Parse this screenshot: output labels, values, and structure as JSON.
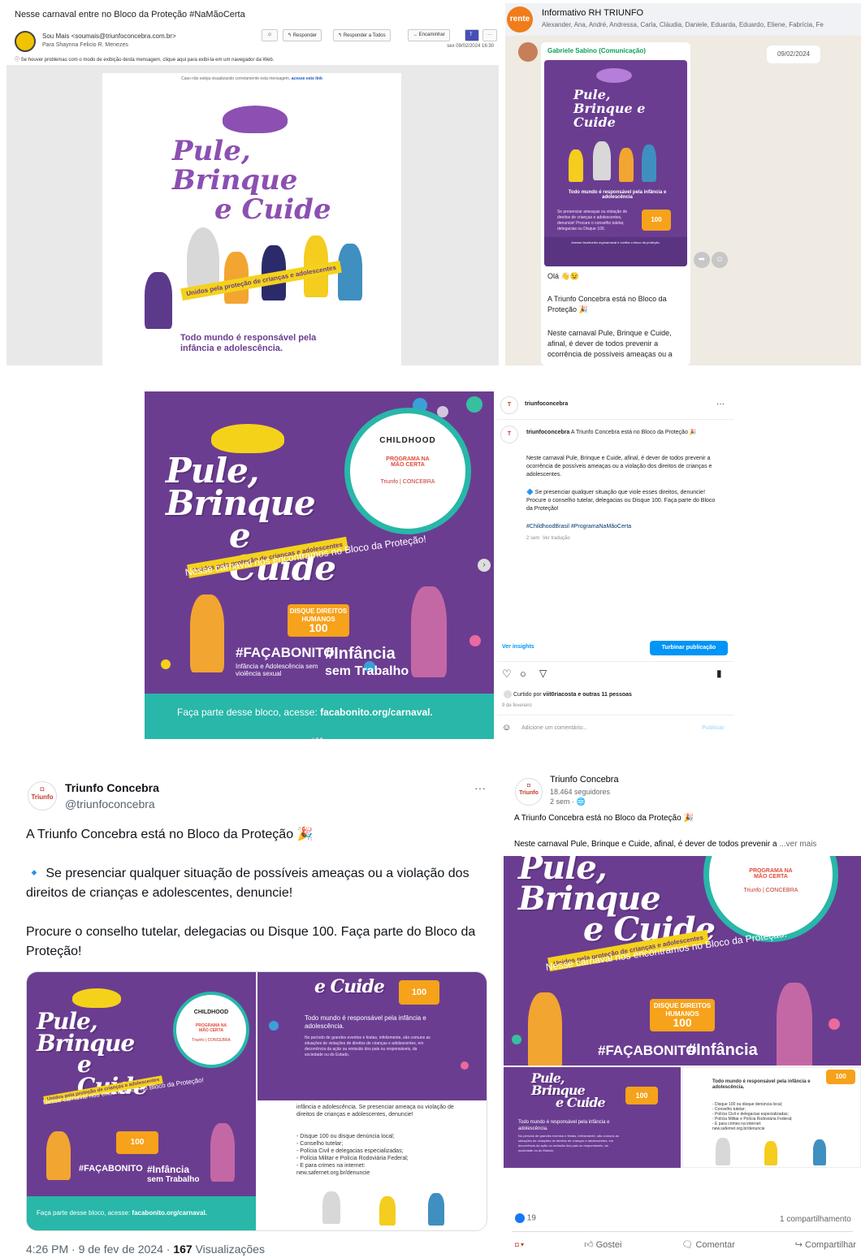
{
  "email": {
    "subject": "Nesse carnaval entre no Bloco da Proteção #NaMãoCerta",
    "sender": "Sou Mais <soumais@triunfoconcebra.com.br>",
    "to": "Para   Shaynna Felicio R. Menezes",
    "buttons": [
      "Responder",
      "Responder a Todos",
      "Encaminhar",
      "···"
    ],
    "date": "sex 09/02/2024 16:30",
    "warning": "Se houver problemas com o modo de exibição desta mensagem, clique aqui para exibi-la em um navegador da Web.",
    "notice_text": "Caso não esteja visualizando corretamente esta mensagem,",
    "notice_link": "acesse este link",
    "poster": {
      "title_line1": "Pule, Brinque",
      "title_line2": "e Cuide",
      "ribbon": "Unidos pela proteção de crianças e adolescentes",
      "footer": "Todo mundo é responsável pela infância e adolescência."
    }
  },
  "rh": {
    "group_logo": "rente",
    "title": "Informativo RH TRIUNFO",
    "members": "Alexander, Ana, André, Andressa, Carla, Cláudia, Daniele, Eduarda, Eduardo, Eliene, Fabrícia, Fe",
    "sender": "Gabriele Sabino (Comunicação)",
    "date": "09/02/2024",
    "msg_hello": "Olá 👋😉",
    "msg_1": "A Triunfo Concebra está no Bloco da Proteção 🎉",
    "msg_2": "Neste carnaval Pule, Brinque e Cuide, afinal, é dever de todos prevenir a ocorrência de possíveis ameaças ou a violação dos direitos",
    "mini_poster_title": "Pule, Brinque e Cuide",
    "mini_poster_text": "Todo mundo é responsável pela infância e adolescência",
    "mini_poster_cta": "Se presenciar ameaças ou violação de direitos de crianças e adolescentes, denuncie! Procure o conselho tutelar, delegacias ou Disque 100.",
    "mini_poster_footer": "Acesse facebonito.org/carnaval e confira o bloco da proteção."
  },
  "poster_main": {
    "title_line1": "Pule, Brinque",
    "title_line2": "e Cuide",
    "ribbon": "Unidos pela proteção de crianças e adolescentes",
    "encontro": "Nesse carnaval nos encontramos no Bloco da Proteção!",
    "childhood": "CHILDHOOD",
    "programa": "PROGRAMA NA MÃO CERTA",
    "triunfo": "Triunfo | CONCEBRA",
    "disque_title": "DISQUE DIREITOS HUMANOS",
    "disque_num": "100",
    "faca_bonito": "#FAÇABONITO",
    "faca_sub": "Infância e Adolescência sem violência sexual",
    "infancia": "#Infância",
    "infancia_sub": "sem Trabalho",
    "cta_text": "Faça parte desse bloco, acesse:",
    "cta_link": "facabonito.org/carnaval."
  },
  "instagram": {
    "account": "triunfoconcebra",
    "caption_head": "A Triunfo Concebra está no Bloco da Proteção 🎉",
    "caption_p1": "Neste carnaval Pule, Brinque e Cuide, afinal, é dever de todos prevenir a ocorrência de possíveis ameaças ou a violação dos direitos de crianças e adolescentes.",
    "caption_p2": "🔷 Se presenciar qualquer situação que viole esses direitos, denuncie! Procure o conselho tutelar, delegacias ou Disque 100. Faça parte do Bloco da Proteção!",
    "hashtags": "#ChildhoodBrasil #ProgramaNaMãoCerta",
    "time": "2 sem",
    "translate": "Ver tradução",
    "insights": "Ver insights",
    "boost": "Turbinar publicação",
    "liked_by": "Curtido por",
    "liked_user": "viit0riacosta",
    "liked_others": "e outras 11 pessoas",
    "date": "9 de fevereiro",
    "comment_placeholder": "Adicione um comentário...",
    "publish": "Publicar"
  },
  "twitter": {
    "name": "Triunfo Concebra",
    "handle": "@triunfoconcebra",
    "line1": "A Triunfo Concebra está no Bloco da Proteção 🎉",
    "line2": "🔹 Se presenciar qualquer situação de possíveis ameaças ou a violação dos direitos de crianças e adolescentes, denuncie!",
    "line3": "Procure o conselho tutelar, delegacias ou Disque 100. Faça parte do Bloco da Proteção!",
    "time": "4:26 PM · 9 de fev de 2024 · ",
    "views": "167",
    "views_label": " Visualizações",
    "panel_info_title": "Todo mundo é responsável pela infância e adolescência.",
    "panel_info_body": "No período de grandes eventos e festas, infelizmente, são comuns as situações de violações de direitos de crianças e adolescentes, em decorrência da ação ou omissão dos pais ou responsáveis, da sociedade ou do Estado.",
    "panel_list_intro": "infância e adolescência. Se presenciar ameaça ou violação de direitos de crianças e adolescentes, denuncie!",
    "panel_list": [
      "- Disque 100 ou disque denúncia local;",
      "- Conselho tutelar;",
      "- Polícia Civil e delegacias especializadas;",
      "- Polícia Militar e Polícia Rodoviária Federal;",
      "- E para crimes na internet:",
      "new.safernet.org.br/denuncie"
    ]
  },
  "facebook": {
    "name": "Triunfo Concebra",
    "followers": "18.464 seguidores",
    "time": "2 sem · 🌐",
    "line1": "A Triunfo Concebra está no Bloco da Proteção 🎉",
    "line2": "Neste carnaval Pule, Brinque e Cuide, afinal, é dever de todos prevenir a",
    "more": "...ver mais",
    "reactions": "19",
    "shares": "1 compartilhamento",
    "like": "Gostei",
    "comment": "Comentar",
    "share": "Compartilhar"
  },
  "colors": {
    "purple": "#6b3d91",
    "yellow": "#f5d21a",
    "teal": "#28b7a8",
    "orange": "#f6a21a",
    "blue": "#1d9bf0"
  }
}
